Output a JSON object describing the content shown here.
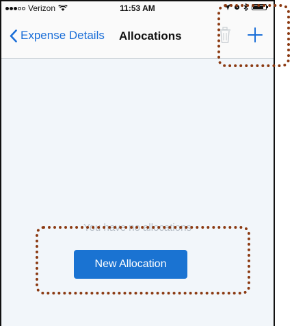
{
  "status_bar": {
    "carrier": "Verizon",
    "time": "11:53 AM"
  },
  "nav": {
    "back_label": "Expense Details",
    "title": "Allocations"
  },
  "content": {
    "empty_message": "You have no allocations",
    "new_button_label": "New Allocation"
  },
  "colors": {
    "accent": "#1a6ed8",
    "button": "#1a73d2",
    "background": "#f2f6fa",
    "annotation": "#8b3a12"
  }
}
